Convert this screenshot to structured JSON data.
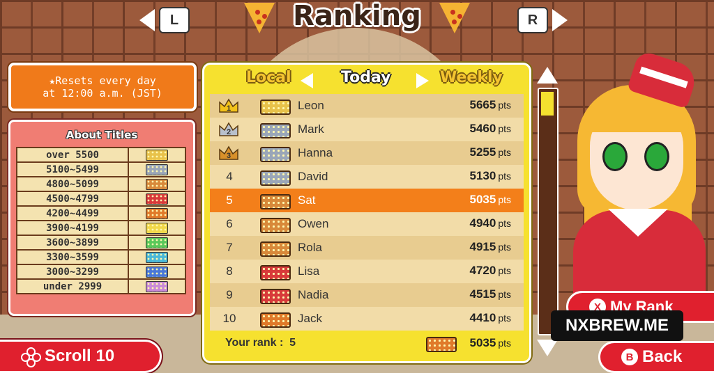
{
  "header": {
    "title": "Ranking",
    "left_key": "L",
    "right_key": "R"
  },
  "reset_notice": {
    "line1": "★Resets every day",
    "line2": "at 12:00 a.m. (JST)"
  },
  "titles_panel": {
    "heading": "About Titles",
    "rows": [
      {
        "range": "over 5500",
        "badge_color": "#e8c24a"
      },
      {
        "range": "5100~5499",
        "badge_color": "#9aa6b8"
      },
      {
        "range": "4800~5099",
        "badge_color": "#d8893a"
      },
      {
        "range": "4500~4799",
        "badge_color": "#d83a3a"
      },
      {
        "range": "4200~4499",
        "badge_color": "#e07a2a"
      },
      {
        "range": "3900~4199",
        "badge_color": "#f2d84a"
      },
      {
        "range": "3600~3899",
        "badge_color": "#5ac85a"
      },
      {
        "range": "3300~3599",
        "badge_color": "#4ab8d8"
      },
      {
        "range": "3000~3299",
        "badge_color": "#4a78d8"
      },
      {
        "range": "under 2999",
        "badge_color": "#c88ad8"
      }
    ]
  },
  "tabs": {
    "local": "Local",
    "today": "Today",
    "weekly": "Weekly"
  },
  "ranking": [
    {
      "rank": "1",
      "crown": "gold",
      "name": "Leon",
      "score": "5665",
      "unit": "pts",
      "badge_color": "#e8c24a"
    },
    {
      "rank": "2",
      "crown": "silver",
      "name": "Mark",
      "score": "5460",
      "unit": "pts",
      "badge_color": "#9aa6b8"
    },
    {
      "rank": "3",
      "crown": "bronze",
      "name": "Hanna",
      "score": "5255",
      "unit": "pts",
      "badge_color": "#9aa6b8"
    },
    {
      "rank": "4",
      "crown": "",
      "name": "David",
      "score": "5130",
      "unit": "pts",
      "badge_color": "#9aa6b8"
    },
    {
      "rank": "5",
      "crown": "",
      "name": "Sat",
      "score": "5035",
      "unit": "pts",
      "badge_color": "#d8893a",
      "highlight": true
    },
    {
      "rank": "6",
      "crown": "",
      "name": "Owen",
      "score": "4940",
      "unit": "pts",
      "badge_color": "#d8893a"
    },
    {
      "rank": "7",
      "crown": "",
      "name": "Rola",
      "score": "4915",
      "unit": "pts",
      "badge_color": "#d8893a"
    },
    {
      "rank": "8",
      "crown": "",
      "name": "Lisa",
      "score": "4720",
      "unit": "pts",
      "badge_color": "#d83a3a"
    },
    {
      "rank": "9",
      "crown": "",
      "name": "Nadia",
      "score": "4515",
      "unit": "pts",
      "badge_color": "#d83a3a"
    },
    {
      "rank": "10",
      "crown": "",
      "name": "Jack",
      "score": "4410",
      "unit": "pts",
      "badge_color": "#e07a2a"
    }
  ],
  "your_rank": {
    "label": "Your rank :",
    "rank": "5",
    "score": "5035",
    "unit": "pts"
  },
  "buttons": {
    "scroll": "Scroll 10",
    "my_rank": "My Rank",
    "my_rank_key": "X",
    "back": "Back",
    "back_key": "B"
  },
  "watermark": "NXBREW.ME",
  "colors": {
    "panel_yellow": "#f6e12f",
    "highlight_orange": "#f37f1a",
    "button_red": "#e0202e",
    "notice_orange": "#f07a1a"
  }
}
